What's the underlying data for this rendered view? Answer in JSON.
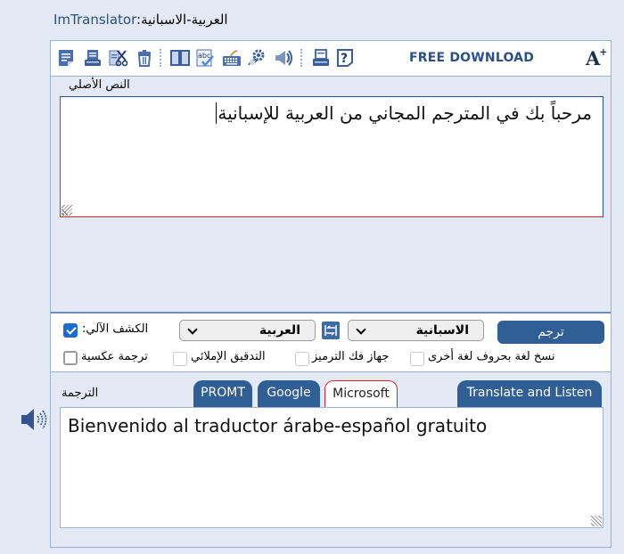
{
  "header": {
    "app_name": "ImTranslator",
    "separator": ":",
    "language_pair": "العربية-الاسبانية"
  },
  "toolbar": {
    "icons": [
      {
        "name": "paste-icon"
      },
      {
        "name": "print-preview-icon"
      },
      {
        "name": "cut-icon"
      },
      {
        "name": "clear-trash-icon"
      },
      {
        "name": "dictionary-icon"
      },
      {
        "name": "spell-check-icon"
      },
      {
        "name": "virtual-keyboard-icon"
      },
      {
        "name": "settings-decoder-icon"
      },
      {
        "name": "text-to-speech-icon"
      },
      {
        "name": "print-icon"
      },
      {
        "name": "help-icon"
      }
    ],
    "free_download": "FREE DOWNLOAD",
    "font_size_label": "A",
    "font_size_plus": "+"
  },
  "source": {
    "label": "النص الأصلي",
    "text": "مرحباً بك في المترجم المجاني من العربية للإسبانية"
  },
  "controls": {
    "auto_detect_label": ":الكشف الآلي",
    "auto_detect_checked": true,
    "source_language": "العربية",
    "target_language": "الاسبانية",
    "translate_button": "ترجم",
    "options": [
      {
        "label": "نسخ لغة بحروف لغة أخرى",
        "checked": false
      },
      {
        "label": "جهاز فك الترميز",
        "checked": false
      },
      {
        "label": "التدقيق الإملائي",
        "checked": false
      },
      {
        "label": "ترجمة عكسية",
        "checked": false
      }
    ]
  },
  "output": {
    "label": "الترجمة",
    "tabs": [
      {
        "label": "PROMT",
        "active": false
      },
      {
        "label": "Google",
        "active": false
      },
      {
        "label": "Microsoft",
        "active": true
      }
    ],
    "translate_listen": "Translate and Listen",
    "text": "Bienvenido al traductor árabe-español gratuito"
  },
  "colors": {
    "accent": "#2f5f95",
    "background": "#e3eaf5",
    "active_border": "#e0202a",
    "checkbox_checked": "#1c6bd1"
  }
}
